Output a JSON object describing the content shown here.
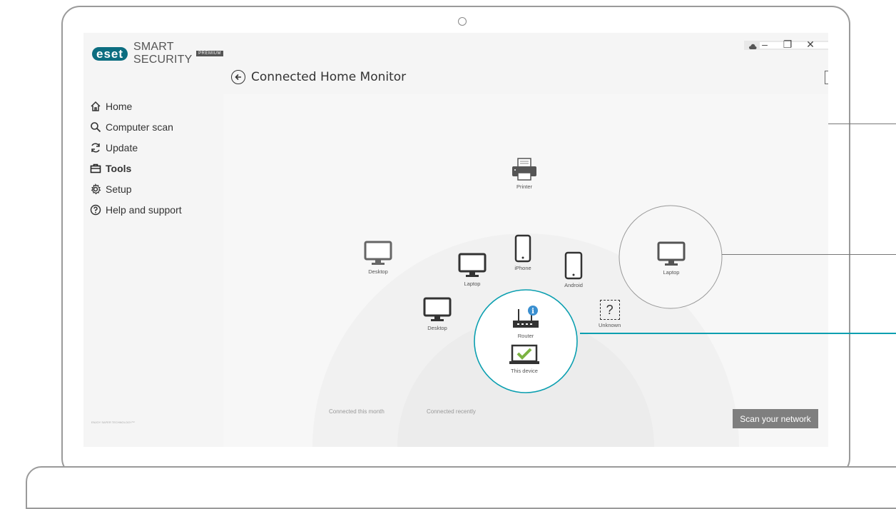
{
  "app": {
    "logo_badge": "eset",
    "logo_text": "SMART SECURITY",
    "premium_badge": "PREMIUM",
    "footer": "ENJOY SAFER TECHNOLOGY™"
  },
  "window": {
    "minimize": "–",
    "restore": "❐",
    "close": "✕"
  },
  "header": {
    "title": "Connected Home Monitor",
    "dropdown_value": "",
    "menu_icon": "hamburger-circle-icon",
    "help_label": "?"
  },
  "sidebar": {
    "items": [
      {
        "label": "Home",
        "icon": "home-icon"
      },
      {
        "label": "Computer scan",
        "icon": "search-icon"
      },
      {
        "label": "Update",
        "icon": "refresh-icon"
      },
      {
        "label": "Tools",
        "icon": "briefcase-icon",
        "active": true
      },
      {
        "label": "Setup",
        "icon": "gear-icon"
      },
      {
        "label": "Help and support",
        "icon": "help-icon"
      }
    ]
  },
  "devices": {
    "printer": "Printer",
    "desktop_outer": "Desktop",
    "laptop_outer": "Laptop",
    "iphone": "iPhone",
    "laptop_inner": "Laptop",
    "android": "Android",
    "desktop_inner": "Desktop",
    "router": "Router",
    "unknown": "Unknown",
    "unknown_mark": "?",
    "this_device": "This device"
  },
  "legend": {
    "month": "Connected this month",
    "recently": "Connected recently"
  },
  "actions": {
    "scan": "Scan your network"
  },
  "colors": {
    "accent": "#0b9fb0",
    "brand": "#0c6d80",
    "check": "#7cb342",
    "info": "#3a8fd0"
  }
}
